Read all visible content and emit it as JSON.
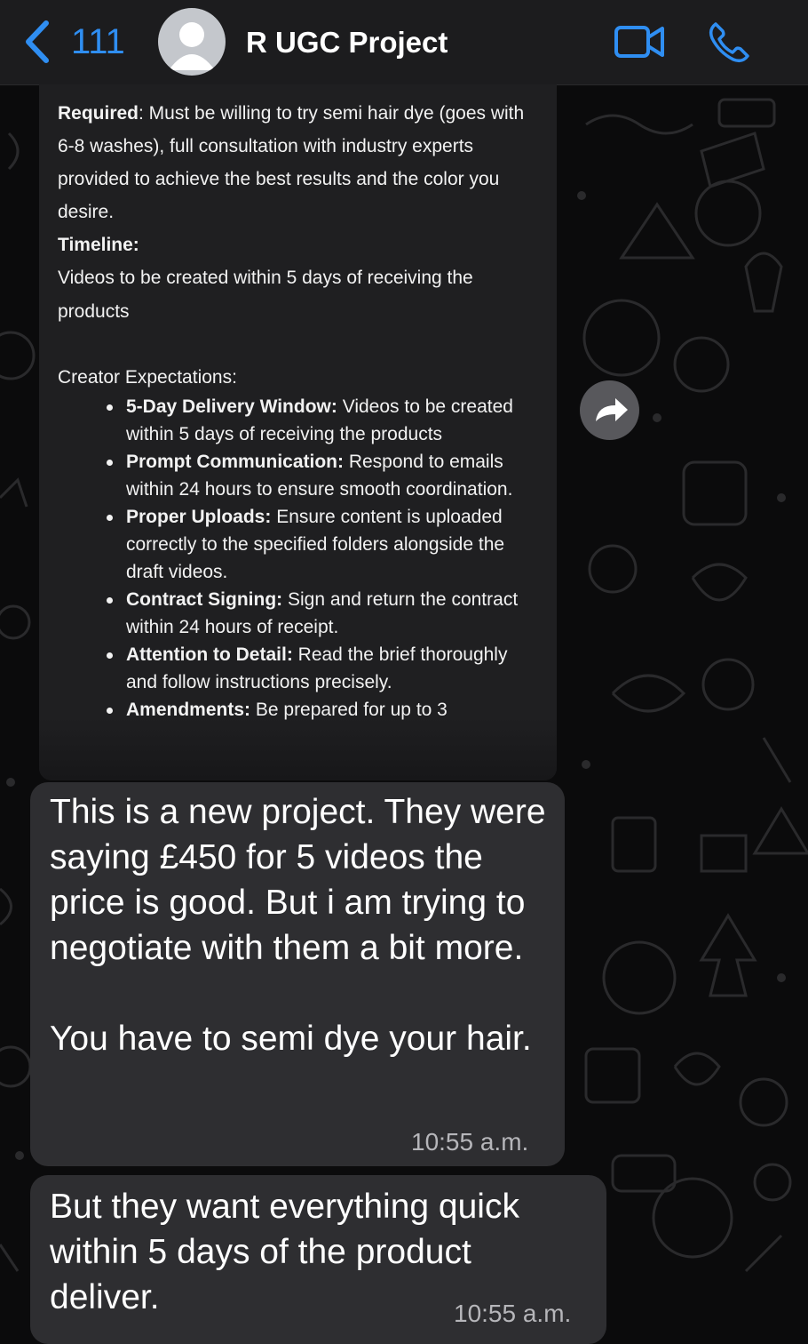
{
  "header": {
    "back_count": "111",
    "chat_title": "R UGC Project",
    "accent_color": "#2f8ef2",
    "icons": [
      "chevron-left-icon",
      "avatar-person-icon",
      "video-call-icon",
      "phone-icon"
    ]
  },
  "forwarded": {
    "required_label": "Required",
    "required_text": ": Must be willing to try semi hair dye (goes with 6-8 washes), full consultation with industry experts provided to achieve the best results and the color you desire.",
    "timeline_label": "Timeline:",
    "timeline_text": "Videos to be created within 5 days of receiving the products",
    "expectations_heading": "Creator Expectations:",
    "expectations": [
      {
        "title": "5-Day Delivery Window:",
        "text": " Videos to be created within 5 days of receiving the products"
      },
      {
        "title": "Prompt Communication:",
        "text": " Respond to emails within 24 hours to ensure smooth coordination."
      },
      {
        "title": "Proper Uploads:",
        "text": " Ensure content is uploaded correctly to the specified folders alongside the draft videos."
      },
      {
        "title": "Contract Signing:",
        "text": " Sign and return the contract within 24 hours of receipt."
      },
      {
        "title": "Attention to Detail:",
        "text": " Read the brief thoroughly and follow instructions precisely."
      },
      {
        "title": "Amendments:",
        "text": " Be prepared for up to 3"
      }
    ]
  },
  "messages": [
    {
      "text": "This is a new project. They were saying £450 for 5 videos the price is good. But i am trying to negotiate with them a bit more.\n\nYou have to semi dye your hair.",
      "time": "10:55 a.m."
    },
    {
      "text": "But they want everything quick within 5 days of the product deliver.",
      "time": "10:55 a.m."
    }
  ]
}
